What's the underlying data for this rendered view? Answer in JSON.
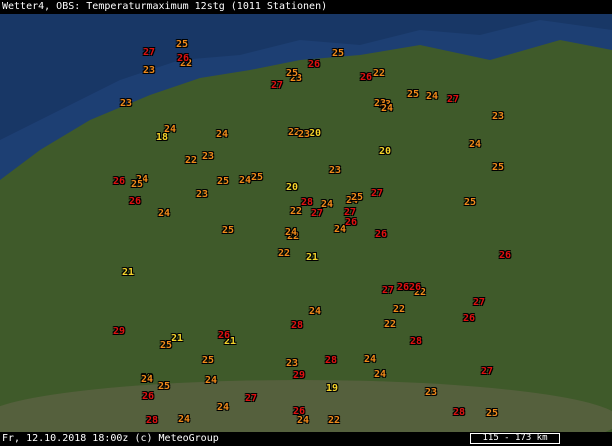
{
  "title": "Wetter4, OBS: Temperaturmaximum 12stg (1011 Stationen)",
  "footer": "Fr, 12.10.2018 18:00z (c) MeteoGroup",
  "scale": "115 - 173 km",
  "colors": {
    "sea": "#1d3f73",
    "land": "#3f5a2a",
    "warm": "#e01010",
    "mid": "#f08a1a",
    "cool": "#f6d42a"
  },
  "observations": [
    "21",
    "18",
    "22",
    "19",
    "24",
    "21",
    "22",
    "20",
    "23",
    "24",
    "22",
    "25",
    "24",
    "23",
    "22",
    "20",
    "24",
    "22",
    "23",
    "21",
    "25",
    "26",
    "24",
    "23",
    "25",
    "22",
    "24",
    "23",
    "26",
    "27",
    "25",
    "24",
    "23",
    "22",
    "24",
    "25",
    "26",
    "28",
    "27",
    "26",
    "25",
    "24",
    "23",
    "22",
    "24",
    "26",
    "27",
    "28",
    "29",
    "26",
    "25",
    "24",
    "23",
    "22",
    "24",
    "25",
    "26",
    "27",
    "28",
    "27",
    "26",
    "25",
    "24",
    "23",
    "24",
    "25",
    "26",
    "27",
    "28",
    "29",
    "28",
    "27",
    "26",
    "25",
    "24",
    "23",
    "22",
    "21",
    "20",
    "19",
    "24",
    "25",
    "26",
    "27",
    "26",
    "25",
    "24",
    "23",
    "22",
    "24",
    "25",
    "26",
    "27",
    "28",
    "27",
    "26",
    "25",
    "24",
    "23",
    "24"
  ]
}
